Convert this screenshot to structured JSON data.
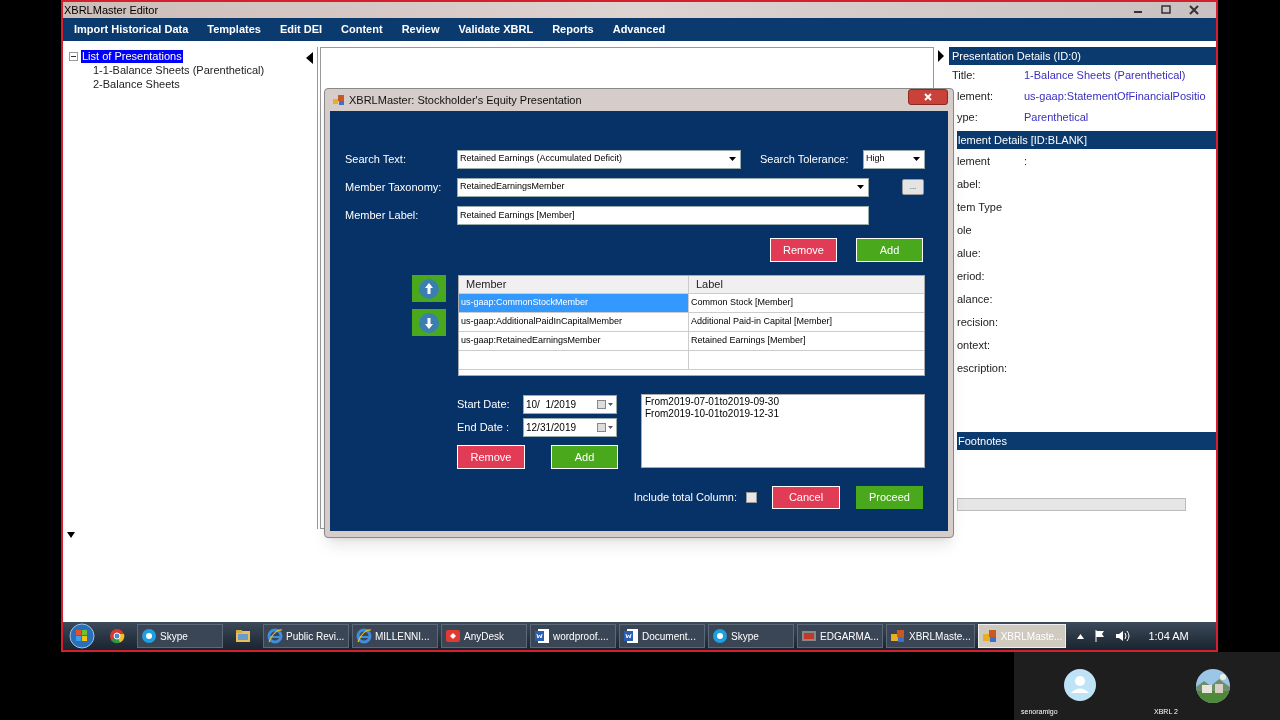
{
  "app": {
    "title": "XBRLMaster Editor",
    "menu": [
      "Import Historical Data",
      "Templates",
      "Edit DEI",
      "Content",
      "Review",
      "Validate XBRL",
      "Reports",
      "Advanced"
    ]
  },
  "tree": {
    "root": {
      "label": "List of Presentations",
      "selected": true,
      "expanded": true,
      "children": [
        {
          "label": "1-1-Balance Sheets (Parenthetical)"
        },
        {
          "label": "2-Balance Sheets"
        }
      ]
    }
  },
  "details": {
    "presentation_header": "Presentation Details (ID:0)",
    "presentation_fields": [
      {
        "label": "Title:",
        "value": "1-Balance Sheets (Parenthetical)"
      },
      {
        "label": "lement:",
        "value": "us-gaap:StatementOfFinancialPositio"
      },
      {
        "label": "ype:",
        "value": "Parenthetical"
      }
    ],
    "element_header": "lement Details [ID:BLANK]",
    "element_fields": [
      {
        "label": "lement",
        "value": ":"
      },
      {
        "label": "abel:"
      },
      {
        "label": "tem Type"
      },
      {
        "label": "ole"
      },
      {
        "label": "alue:"
      },
      {
        "label": "eriod:"
      },
      {
        "label": "alance:"
      },
      {
        "label": "recision:"
      },
      {
        "label": "ontext:"
      },
      {
        "label": "escription:"
      }
    ],
    "footnotes_header": "Footnotes"
  },
  "dialog": {
    "title": "XBRLMaster: Stockholder's Equity Presentation",
    "search_text": {
      "label": "Search Text:",
      "value": "Retained Earnings (Accumulated Deficit)"
    },
    "search_tolerance": {
      "label": "Search Tolerance:",
      "value": "High"
    },
    "member_taxonomy": {
      "label": "Member Taxonomy:",
      "value": "RetainedEarningsMember",
      "browse": "..."
    },
    "member_label": {
      "label": "Member Label:",
      "value": "Retained Earnings [Member]"
    },
    "member_buttons": [
      "Remove",
      "Add"
    ],
    "table": {
      "columns": [
        "Member",
        "Label"
      ],
      "rows": [
        {
          "member": "us-gaap:CommonStockMember",
          "label": "Common Stock [Member]",
          "selected": true
        },
        {
          "member": "us-gaap:AdditionalPaidInCapitalMember",
          "label": "Additional Paid-in Capital [Member]",
          "selected": false
        },
        {
          "member": "us-gaap:RetainedEarningsMember",
          "label": "Retained Earnings [Member]",
          "selected": false
        }
      ]
    },
    "start_date": {
      "label": "Start Date:",
      "value": "10/  1/2019"
    },
    "end_date": {
      "label": "End Date :",
      "value": "12/31/2019"
    },
    "date_buttons": [
      "Remove",
      "Add"
    ],
    "periods": [
      "From2019-07-01to2019-09-30",
      "From2019-10-01to2019-12-31"
    ],
    "include_total": {
      "label": "Include total Column:",
      "checked": false
    },
    "cancel": "Cancel",
    "proceed": "Proceed"
  },
  "taskbar": {
    "items": [
      {
        "selected": false
      },
      {
        "label": "Skype",
        "selected": false
      },
      {
        "selected": false
      },
      {
        "label": "Public Revi...",
        "selected": false
      },
      {
        "label": "MILLENNI...",
        "selected": false
      },
      {
        "label": "AnyDesk",
        "selected": false
      },
      {
        "label": "wordproof....",
        "selected": false
      },
      {
        "label": "Document...",
        "selected": false
      },
      {
        "label": "Skype",
        "selected": false
      },
      {
        "label": "EDGARMA...",
        "selected": false
      },
      {
        "label": "XBRLMaste...",
        "selected": false
      },
      {
        "label": "XBRLMaste...",
        "selected": true
      }
    ],
    "time": "1:04 AM"
  },
  "participants": [
    {
      "name": "senoramigo",
      "kind": "avatar"
    },
    {
      "name": "XBRL 2",
      "kind": "picture"
    }
  ]
}
